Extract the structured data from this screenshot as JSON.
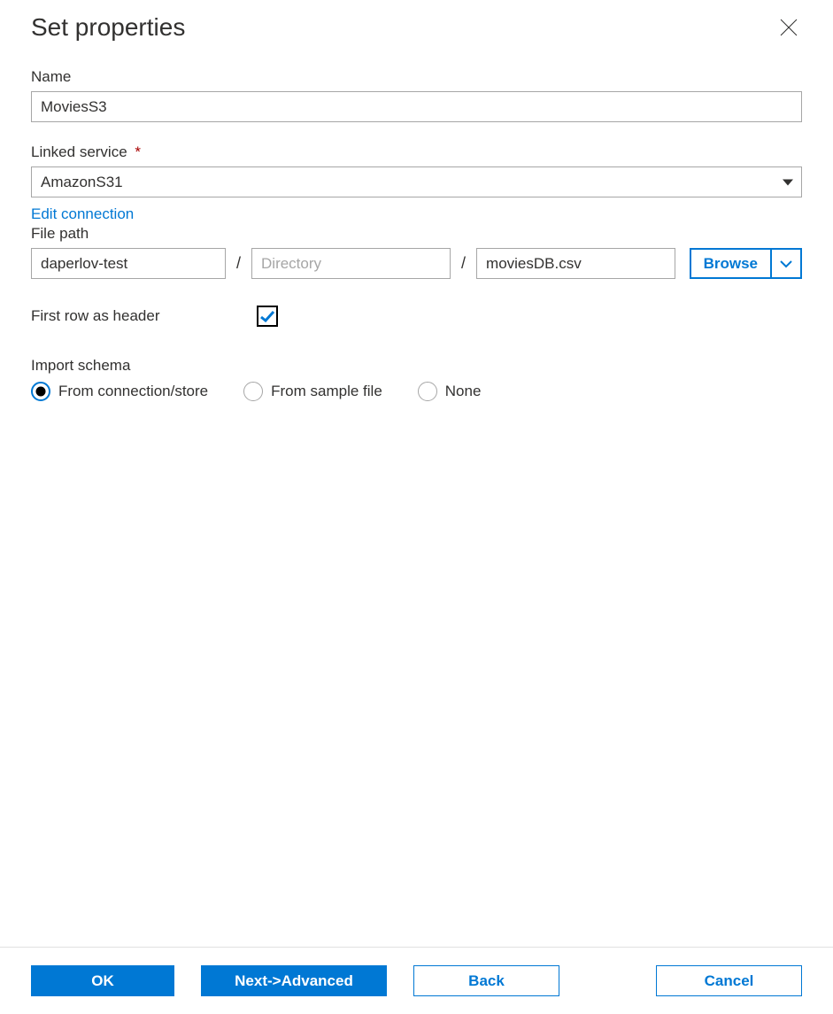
{
  "header": {
    "title": "Set properties",
    "close_icon": "close"
  },
  "fields": {
    "name_label": "Name",
    "name_value": "MoviesS3",
    "linked_service_label": "Linked service",
    "linked_service_required": "*",
    "linked_service_value": "AmazonS31",
    "edit_connection_link": "Edit connection",
    "file_path_label": "File path",
    "file_path": {
      "bucket_value": "daperlov-test",
      "directory_placeholder": "Directory",
      "directory_value": "",
      "file_value": "moviesDB.csv",
      "sep": "/"
    },
    "browse_label": "Browse",
    "first_row_label": "First row as header",
    "first_row_checked": true,
    "import_schema_label": "Import schema",
    "import_schema_options": [
      {
        "label": "From connection/store",
        "selected": true
      },
      {
        "label": "From sample file",
        "selected": false
      },
      {
        "label": "None",
        "selected": false
      }
    ]
  },
  "footer": {
    "ok_label": "OK",
    "next_label": "Next->Advanced",
    "back_label": "Back",
    "cancel_label": "Cancel"
  },
  "colors": {
    "accent": "#0078d4",
    "border": "#a6a6a6",
    "text": "#323130"
  }
}
